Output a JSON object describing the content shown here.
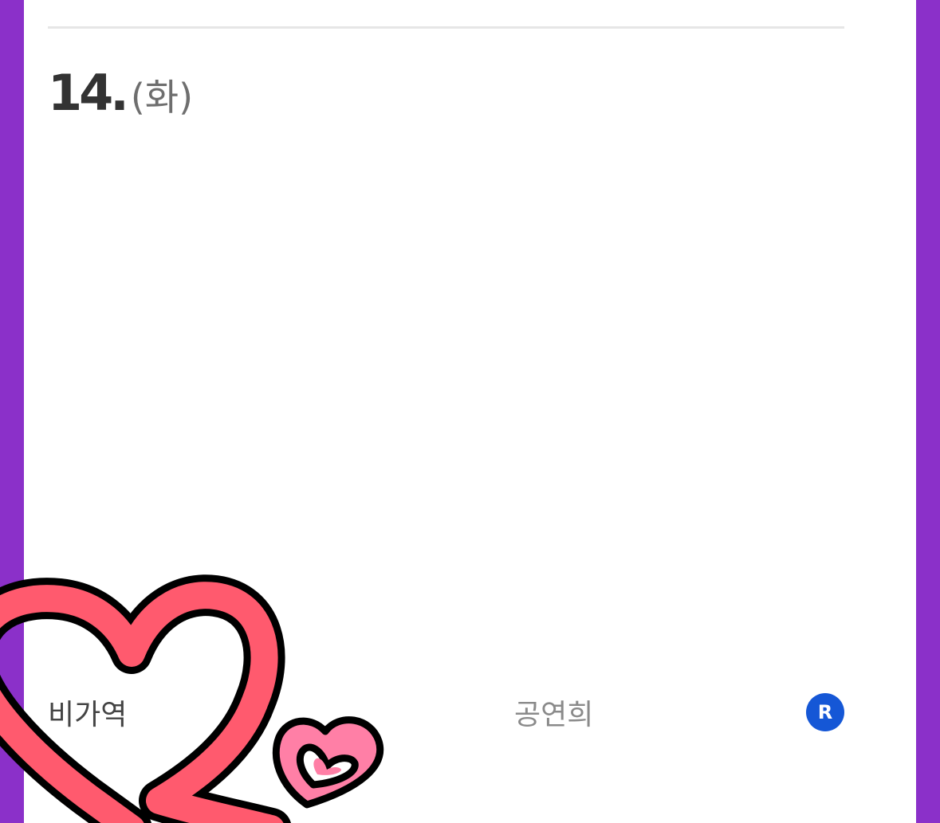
{
  "schedule": {
    "date_number": "14.",
    "weekday": "(화)",
    "entry": {
      "left_text": "비가역",
      "center_text": "공연희",
      "badge": "R"
    }
  },
  "colors": {
    "frame": "#8b30c9",
    "badge": "#1557d6",
    "heart_large": "#ff5a6e",
    "heart_small": "#ff7fa6"
  },
  "decorations": {
    "large_heart_icon": "heart-ribbon-icon",
    "small_heart_icon": "heart-icon"
  }
}
